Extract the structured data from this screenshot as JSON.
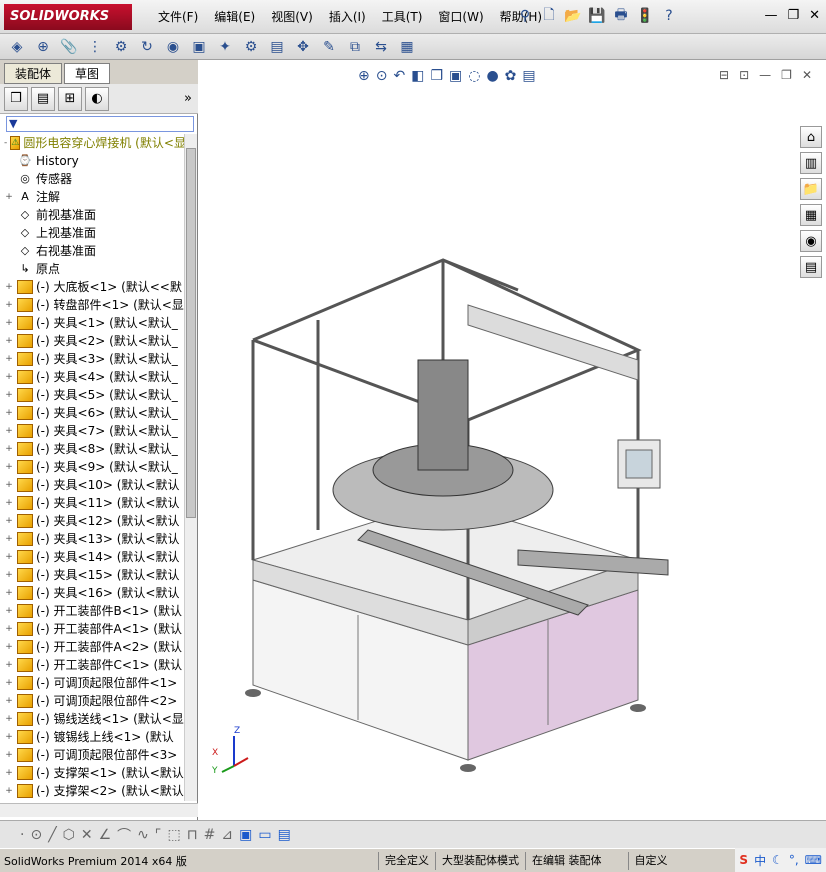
{
  "app": {
    "logo": "SOLIDWORKS"
  },
  "menu": [
    "文件(F)",
    "编辑(E)",
    "视图(V)",
    "插入(I)",
    "工具(T)",
    "窗口(W)",
    "帮助(H)"
  ],
  "panel": {
    "tabs": [
      "装配体",
      "草图"
    ],
    "filter_icon": "filter-icon",
    "tree": [
      {
        "label": "圆形电容穿心焊接机 (默认<显",
        "icon": "assembly",
        "expand": "-",
        "color": "#808000"
      },
      {
        "label": "History",
        "icon": "history",
        "expand": ""
      },
      {
        "label": "传感器",
        "icon": "sensor",
        "expand": ""
      },
      {
        "label": "注解",
        "icon": "annotation",
        "expand": "+"
      },
      {
        "label": "前视基准面",
        "icon": "plane",
        "expand": ""
      },
      {
        "label": "上视基准面",
        "icon": "plane",
        "expand": ""
      },
      {
        "label": "右视基准面",
        "icon": "plane",
        "expand": ""
      },
      {
        "label": "原点",
        "icon": "origin",
        "expand": ""
      },
      {
        "label": "(-) 大底板<1> (默认<<默",
        "icon": "part",
        "expand": "+"
      },
      {
        "label": "(-) 转盘部件<1> (默认<显",
        "icon": "part",
        "expand": "+"
      },
      {
        "label": "(-) 夹具<1> (默认<默认_",
        "icon": "part",
        "expand": "+"
      },
      {
        "label": "(-) 夹具<2> (默认<默认_",
        "icon": "part",
        "expand": "+"
      },
      {
        "label": "(-) 夹具<3> (默认<默认_",
        "icon": "part",
        "expand": "+"
      },
      {
        "label": "(-) 夹具<4> (默认<默认_",
        "icon": "part",
        "expand": "+"
      },
      {
        "label": "(-) 夹具<5> (默认<默认_",
        "icon": "part",
        "expand": "+"
      },
      {
        "label": "(-) 夹具<6> (默认<默认_",
        "icon": "part",
        "expand": "+"
      },
      {
        "label": "(-) 夹具<7> (默认<默认_",
        "icon": "part",
        "expand": "+"
      },
      {
        "label": "(-) 夹具<8> (默认<默认_",
        "icon": "part",
        "expand": "+"
      },
      {
        "label": "(-) 夹具<9> (默认<默认_",
        "icon": "part",
        "expand": "+"
      },
      {
        "label": "(-) 夹具<10> (默认<默认",
        "icon": "part",
        "expand": "+"
      },
      {
        "label": "(-) 夹具<11> (默认<默认",
        "icon": "part",
        "expand": "+"
      },
      {
        "label": "(-) 夹具<12> (默认<默认",
        "icon": "part",
        "expand": "+"
      },
      {
        "label": "(-) 夹具<13> (默认<默认",
        "icon": "part",
        "expand": "+"
      },
      {
        "label": "(-) 夹具<14> (默认<默认",
        "icon": "part",
        "expand": "+"
      },
      {
        "label": "(-) 夹具<15> (默认<默认",
        "icon": "part",
        "expand": "+"
      },
      {
        "label": "(-) 夹具<16> (默认<默认",
        "icon": "part",
        "expand": "+"
      },
      {
        "label": "(-) 开工装部件B<1> (默认",
        "icon": "part",
        "expand": "+"
      },
      {
        "label": "(-) 开工装部件A<1> (默认",
        "icon": "part",
        "expand": "+"
      },
      {
        "label": "(-) 开工装部件A<2> (默认",
        "icon": "part",
        "expand": "+"
      },
      {
        "label": "(-) 开工装部件C<1> (默认",
        "icon": "part",
        "expand": "+"
      },
      {
        "label": "(-) 可调顶起限位部件<1>",
        "icon": "part",
        "expand": "+"
      },
      {
        "label": "(-) 可调顶起限位部件<2>",
        "icon": "part",
        "expand": "+"
      },
      {
        "label": "(-) 锡线送线<1> (默认<显",
        "icon": "part",
        "expand": "+"
      },
      {
        "label": "(-) 镀锡线上线<1> (默认",
        "icon": "part",
        "expand": "+"
      },
      {
        "label": "(-) 可调顶起限位部件<3>",
        "icon": "part",
        "expand": "+"
      },
      {
        "label": "(-) 支撑架<1> (默认<默认",
        "icon": "part",
        "expand": "+"
      },
      {
        "label": "(-) 支撑架<2> (默认<默认",
        "icon": "part",
        "expand": "+"
      }
    ]
  },
  "triad": {
    "x": "X",
    "y": "Y",
    "z": "Z"
  },
  "status": {
    "product": "SolidWorks Premium 2014 x64 版",
    "definition": "完全定义",
    "mode": "大型装配体模式",
    "editing": "在编辑 装配体",
    "units": "自定义"
  },
  "ime": {
    "label": "中"
  }
}
